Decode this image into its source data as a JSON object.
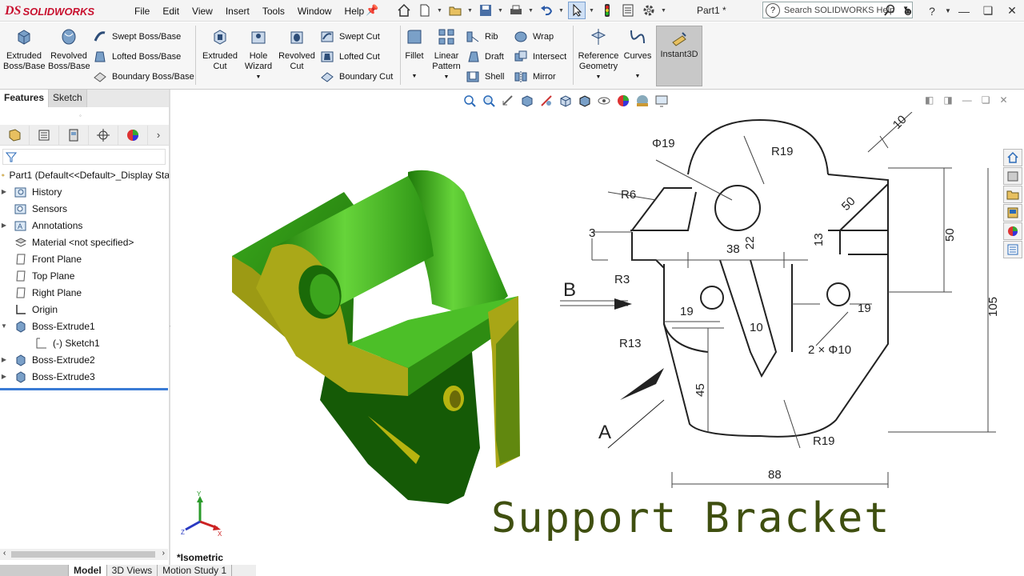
{
  "app": {
    "brand_prefix": "DS",
    "brand": "SOLIDWORKS",
    "doc_title": "Part1 *"
  },
  "menu": [
    "File",
    "Edit",
    "View",
    "Insert",
    "Tools",
    "Window",
    "Help"
  ],
  "search": {
    "placeholder": "Search SOLIDWORKS Help"
  },
  "features_toolbar": {
    "extruded_boss": "Extruded\nBoss/Base",
    "revolved_boss": "Revolved\nBoss/Base",
    "swept_boss": "Swept Boss/Base",
    "lofted_boss": "Lofted Boss/Base",
    "boundary_boss": "Boundary Boss/Base",
    "extruded_cut": "Extruded\nCut",
    "hole_wizard": "Hole\nWizard",
    "revolved_cut": "Revolved\nCut",
    "swept_cut": "Swept Cut",
    "lofted_cut": "Lofted Cut",
    "boundary_cut": "Boundary Cut",
    "fillet": "Fillet",
    "linear_pattern": "Linear\nPattern",
    "rib": "Rib",
    "draft": "Draft",
    "shell": "Shell",
    "wrap": "Wrap",
    "intersect": "Intersect",
    "mirror": "Mirror",
    "reference_geometry": "Reference\nGeometry",
    "curves": "Curves",
    "instant3d": "Instant3D"
  },
  "tabs": {
    "features": "Features",
    "sketch": "Sketch"
  },
  "tree": {
    "root": "Part1  (Default<<Default>_Display Sta",
    "items": [
      {
        "label": "History",
        "expand": true
      },
      {
        "label": "Sensors",
        "expand": false
      },
      {
        "label": "Annotations",
        "expand": true
      },
      {
        "label": "Material <not specified>",
        "expand": false
      },
      {
        "label": "Front Plane",
        "expand": false
      },
      {
        "label": "Top Plane",
        "expand": false
      },
      {
        "label": "Right Plane",
        "expand": false
      },
      {
        "label": "Origin",
        "expand": false
      },
      {
        "label": "Boss-Extrude1",
        "expand": true
      },
      {
        "label": "(-) Sketch1",
        "expand": false
      },
      {
        "label": "Boss-Extrude2",
        "expand": true
      },
      {
        "label": "Boss-Extrude3",
        "expand": true
      }
    ]
  },
  "bottom_tabs": [
    "Model",
    "3D Views",
    "Motion Study 1"
  ],
  "view_label": "*Isometric",
  "caption": "Support Bracket",
  "drawing": {
    "dims": [
      "Φ19",
      "R19",
      "R6",
      "3",
      "38",
      "22",
      "13",
      "50",
      "50",
      "105",
      "10",
      "R3",
      "19",
      "19",
      "10",
      "2 × Φ10",
      "R13",
      "45",
      "R19",
      "88"
    ],
    "letters": [
      "B",
      "A"
    ]
  },
  "colors": {
    "model_green": "#2f9a12",
    "model_yellow": "#9c9a14",
    "caption": "#3f4f10",
    "brand": "#c8102e"
  }
}
